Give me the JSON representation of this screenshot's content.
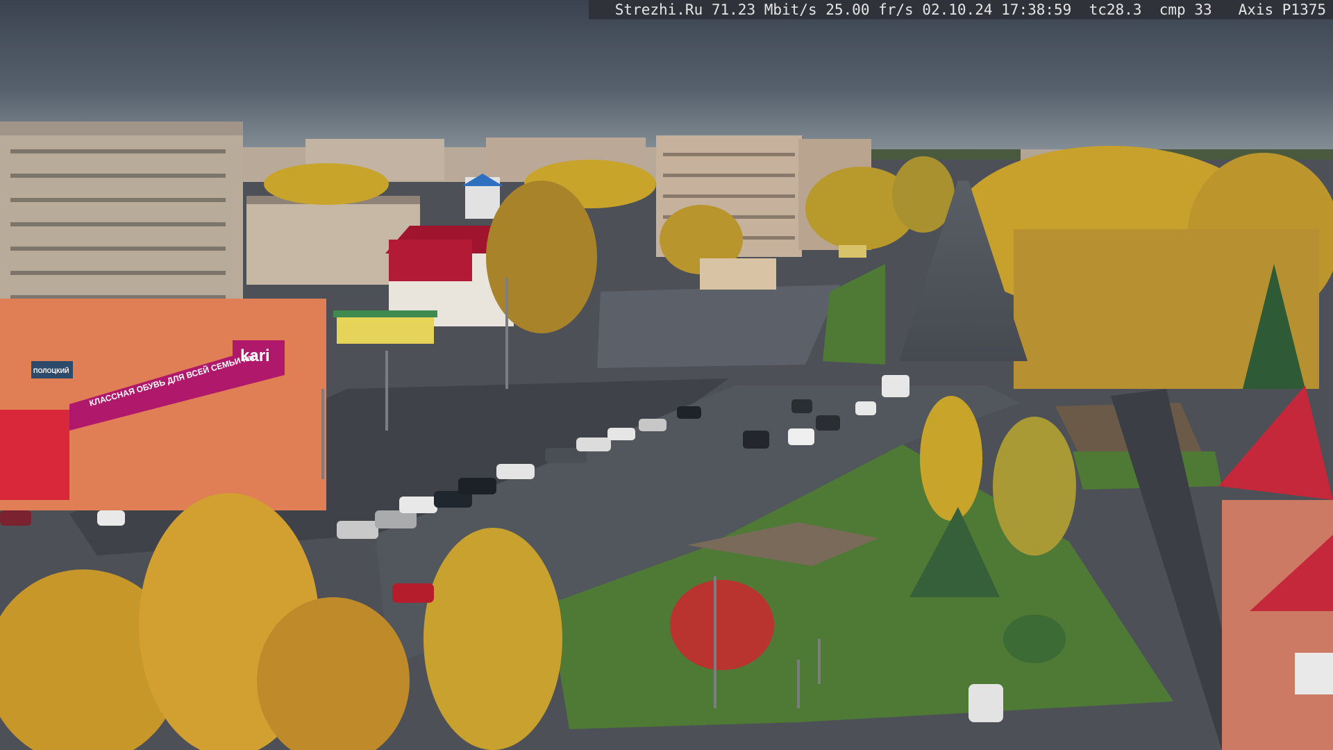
{
  "overlay": {
    "site": "Strezhi.Ru",
    "bitrate": "71.23 Mbit/s",
    "framerate": "25.00 fr/s",
    "date": "02.10.24",
    "time": "17:38:59",
    "tc": "tc28.3",
    "cmp": "cmp 33",
    "camera": "Axis P1375"
  },
  "store_signs": {
    "kari_logo": "kari",
    "kari_banner": "КЛАССНАЯ ОБУВЬ ДЛЯ ВСЕЙ СЕМЬИ kari",
    "shop_sign": "ПОЛОЦКИЙ"
  },
  "colors": {
    "sky_top": "#3b4350",
    "sky_bottom": "#7c8790",
    "foliage_yellow": "#c9a42a",
    "kari_magenta": "#b0196b",
    "building_orange": "#e07e55",
    "roof_red": "#c4283a",
    "grass": "#4f7a35",
    "asphalt": "#4c5058"
  }
}
